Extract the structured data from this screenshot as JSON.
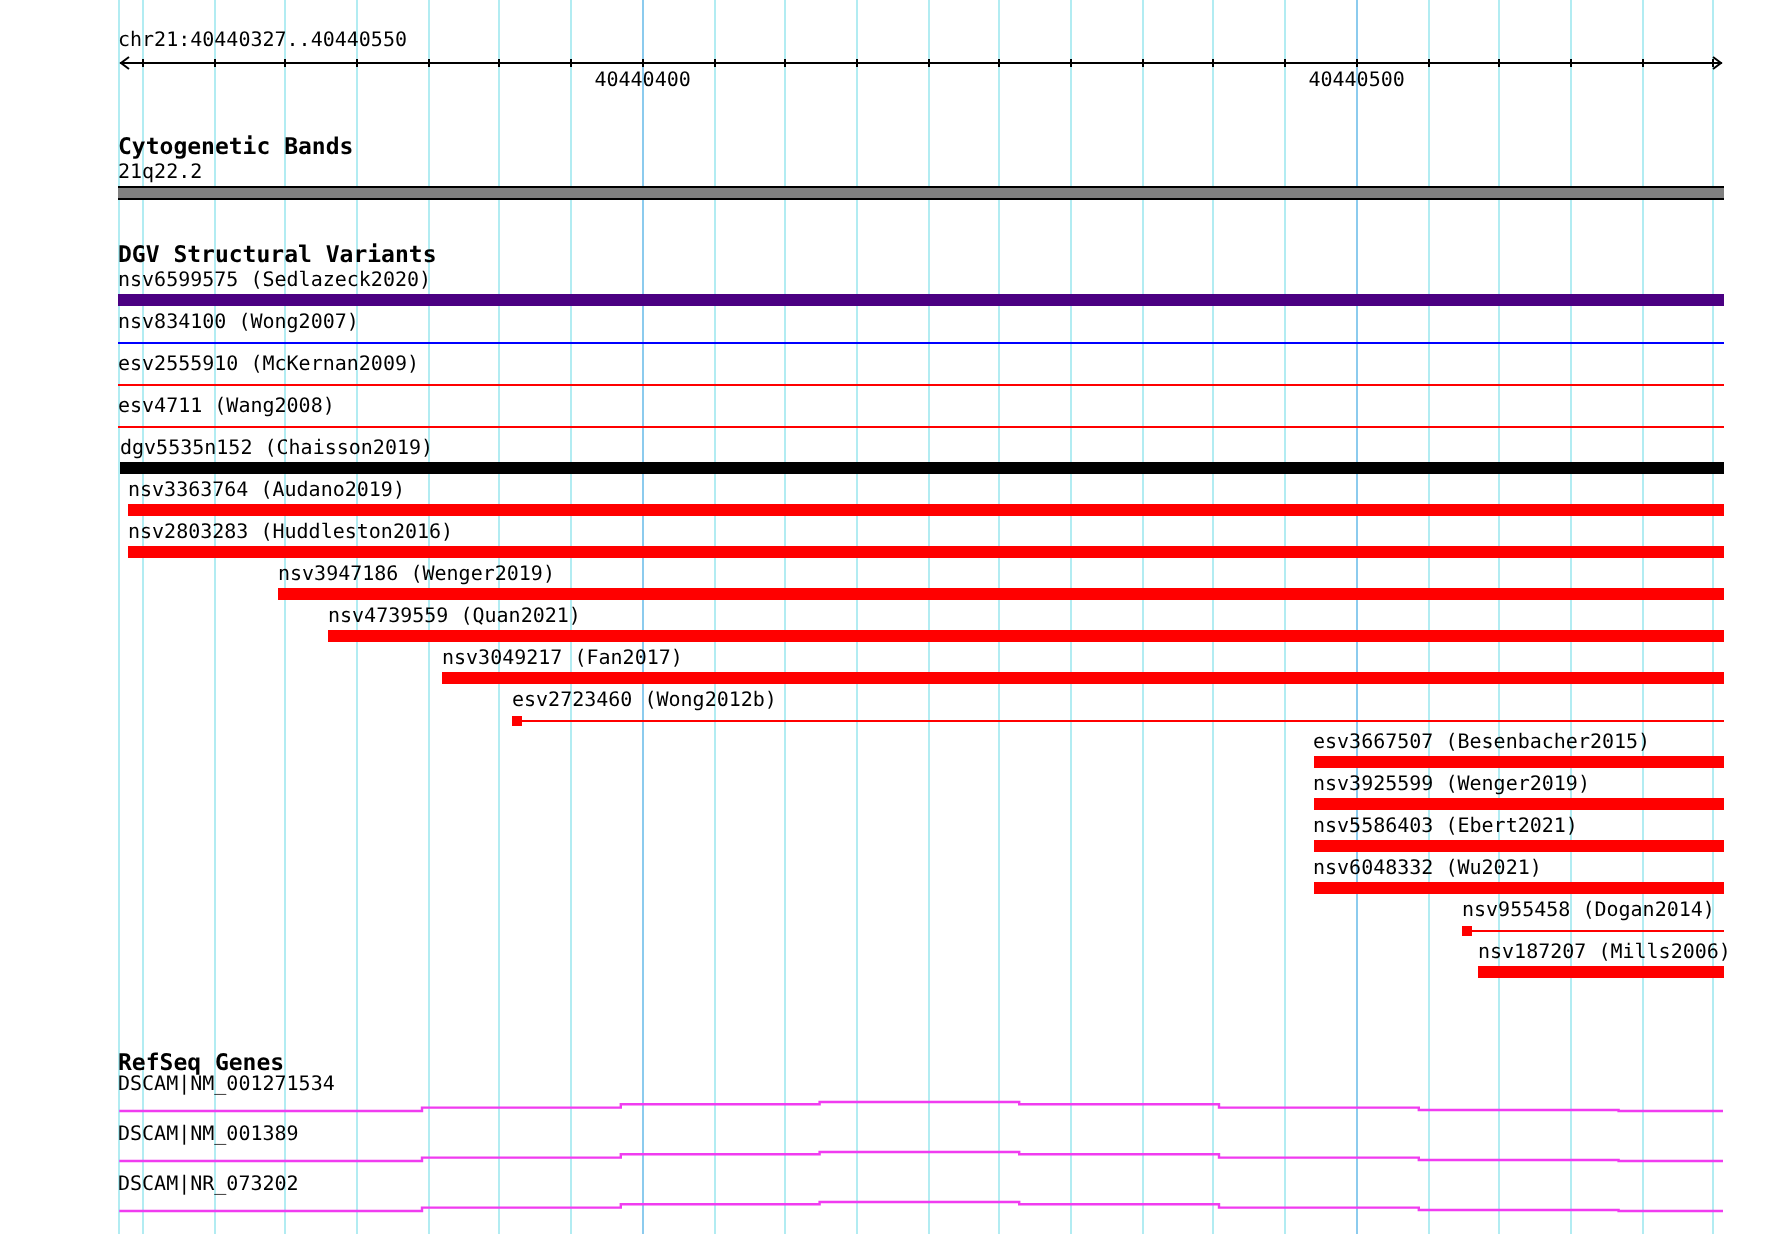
{
  "ruler": {
    "location": "chr21:40440327..40440550",
    "ticks": [
      {
        "label": "40440400"
      },
      {
        "label": "40440500"
      }
    ]
  },
  "tracks": [
    {
      "kind": "cytobands",
      "title": "Cytogenetic Bands",
      "features": [
        {
          "label": "21q22.2"
        }
      ]
    },
    {
      "kind": "variants",
      "title": "DGV Structural Variants",
      "features": [
        {
          "label": "nsv6599575 (Sedlazeck2020)",
          "kind": "bar",
          "color": "#4b0082"
        },
        {
          "label": "nsv834100 (Wong2007)",
          "kind": "line",
          "color": "#0000ff"
        },
        {
          "label": "esv2555910 (McKernan2009)",
          "kind": "line",
          "color": "#ff0000"
        },
        {
          "label": "esv4711 (Wang2008)",
          "kind": "line",
          "color": "#ff0000"
        },
        {
          "label": "dgv5535n152 (Chaisson2019)",
          "kind": "bar",
          "color": "#000000"
        },
        {
          "label": "nsv3363764 (Audano2019)",
          "kind": "bar",
          "color": "#ff0000"
        },
        {
          "label": "nsv2803283 (Huddleston2016)",
          "kind": "bar",
          "color": "#ff0000"
        },
        {
          "label": "nsv3947186 (Wenger2019)",
          "kind": "bar",
          "color": "#ff0000"
        },
        {
          "label": "nsv4739559 (Quan2021)",
          "kind": "bar",
          "color": "#ff0000"
        },
        {
          "label": "nsv3049217 (Fan2017)",
          "kind": "bar",
          "color": "#ff0000"
        },
        {
          "label": "esv2723460 (Wong2012b)",
          "kind": "point",
          "color": "#ff0000"
        },
        {
          "label": "esv3667507 (Besenbacher2015)",
          "kind": "bar",
          "color": "#ff0000"
        },
        {
          "label": "nsv3925599 (Wenger2019)",
          "kind": "bar",
          "color": "#ff0000"
        },
        {
          "label": "nsv5586403 (Ebert2021)",
          "kind": "bar",
          "color": "#ff0000"
        },
        {
          "label": "nsv6048332 (Wu2021)",
          "kind": "bar",
          "color": "#ff0000"
        },
        {
          "label": "nsv955458 (Dogan2014)",
          "kind": "point",
          "color": "#ff0000"
        },
        {
          "label": "nsv187207 (Mills2006)",
          "kind": "bar",
          "color": "#ff0000"
        }
      ]
    },
    {
      "kind": "genes",
      "title": "RefSeq Genes",
      "features": [
        {
          "label": "DSCAM|NM_001271534"
        },
        {
          "label": "DSCAM|NM_001389"
        },
        {
          "label": "DSCAM|NR_073202"
        }
      ]
    }
  ]
}
